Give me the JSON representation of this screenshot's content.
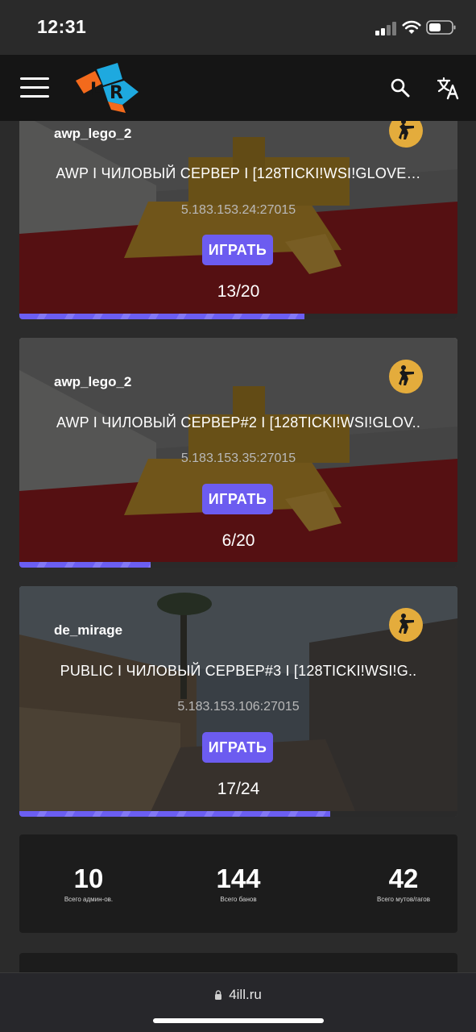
{
  "status_bar": {
    "time": "12:31"
  },
  "header": {
    "logo_text": "LR"
  },
  "servers": [
    {
      "map": "awp_lego_2",
      "name": "AWP I ЧИЛОВЫЙ СЕРВЕР I [128TICKI!WSI!GLOVE…",
      "ip": "5.183.153.24:27015",
      "play_label": "ИГРАТЬ",
      "players": "13/20",
      "fill": 0.65
    },
    {
      "map": "awp_lego_2",
      "name": "AWP I ЧИЛОВЫЙ СЕРВЕР#2 I [128TICKI!WSI!GLOV..",
      "ip": "5.183.153.35:27015",
      "play_label": "ИГРАТЬ",
      "players": "6/20",
      "fill": 0.3
    },
    {
      "map": "de_mirage",
      "name": "PUBLIC I ЧИЛОВЫЙ СЕРВЕР#3 I [128TICKI!WSI!G..",
      "ip": "5.183.153.106:27015",
      "play_label": "ИГРАТЬ",
      "players": "17/24",
      "fill": 0.71
    }
  ],
  "stats": [
    {
      "value": "10",
      "label": "Всего админ-ов."
    },
    {
      "value": "144",
      "label": "Всего банов"
    },
    {
      "value": "42",
      "label": "Всего мутов/гагов"
    }
  ],
  "browser": {
    "url": "4ill.ru"
  },
  "colors": {
    "accent": "#6c5cf0",
    "cs_badge": "#e4ac3c",
    "header_bg": "#151515"
  }
}
